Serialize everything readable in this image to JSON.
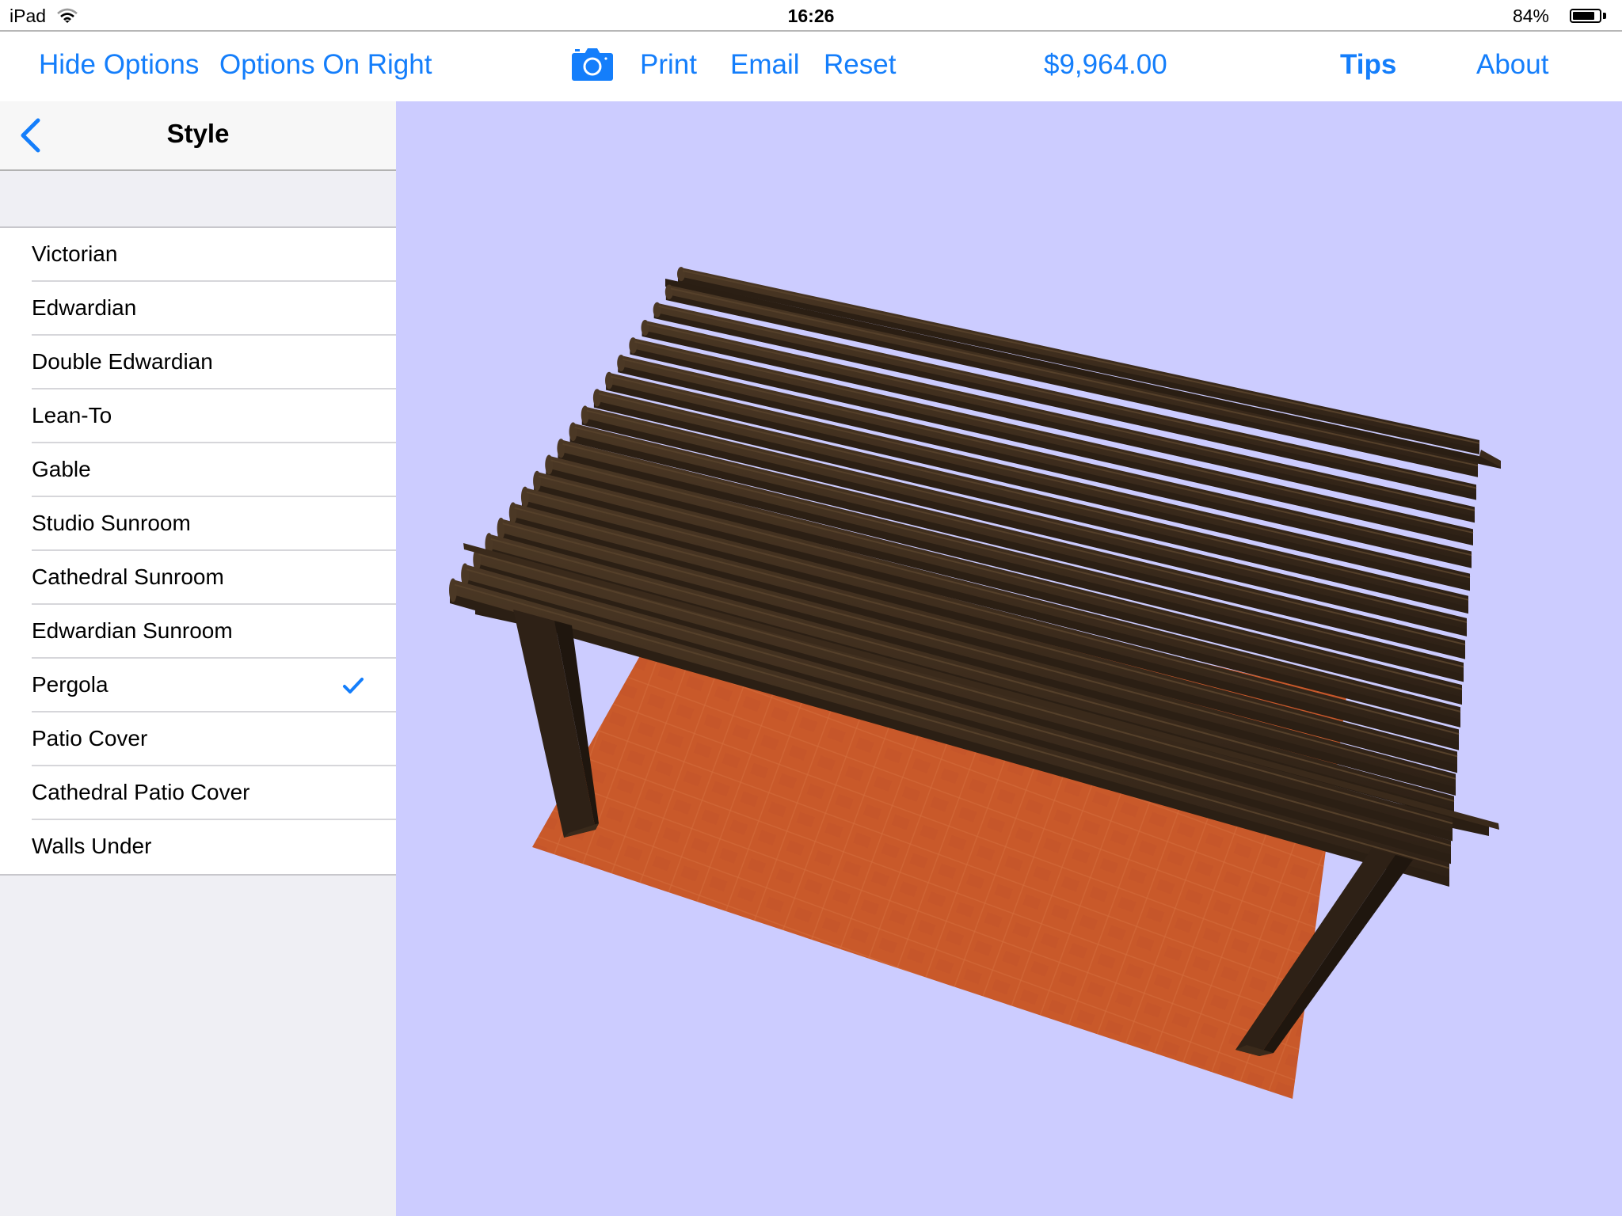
{
  "status_bar": {
    "device": "iPad",
    "time": "16:26",
    "battery_percent_label": "84%",
    "battery_level": 0.84,
    "icons": {
      "wifi": "wifi-icon",
      "battery": "battery-icon"
    }
  },
  "toolbar": {
    "hide_options": "Hide Options",
    "options_on_right": "Options On Right",
    "camera_icon": "camera-icon",
    "print": "Print",
    "email": "Email",
    "reset": "Reset",
    "price": "$9,964.00",
    "tips": "Tips",
    "about": "About",
    "accent_color": "#147efb"
  },
  "sidebar": {
    "back_icon": "chevron-left-icon",
    "title": "Style",
    "items": [
      {
        "label": "Victorian",
        "selected": false
      },
      {
        "label": "Edwardian",
        "selected": false
      },
      {
        "label": "Double Edwardian",
        "selected": false
      },
      {
        "label": "Lean-To",
        "selected": false
      },
      {
        "label": "Gable",
        "selected": false
      },
      {
        "label": "Studio Sunroom",
        "selected": false
      },
      {
        "label": "Cathedral Sunroom",
        "selected": false
      },
      {
        "label": "Edwardian Sunroom",
        "selected": false
      },
      {
        "label": "Pergola",
        "selected": true
      },
      {
        "label": "Patio Cover",
        "selected": false
      },
      {
        "label": "Cathedral Patio Cover",
        "selected": false
      },
      {
        "label": "Walls Under",
        "selected": false
      }
    ],
    "selected_icon": "checkmark-icon"
  },
  "scene": {
    "model": "Pergola",
    "background_color": "#ccccff",
    "floor_color": "#c8582a",
    "wood_color": "#3f2e1e",
    "rafter_count": 20
  }
}
